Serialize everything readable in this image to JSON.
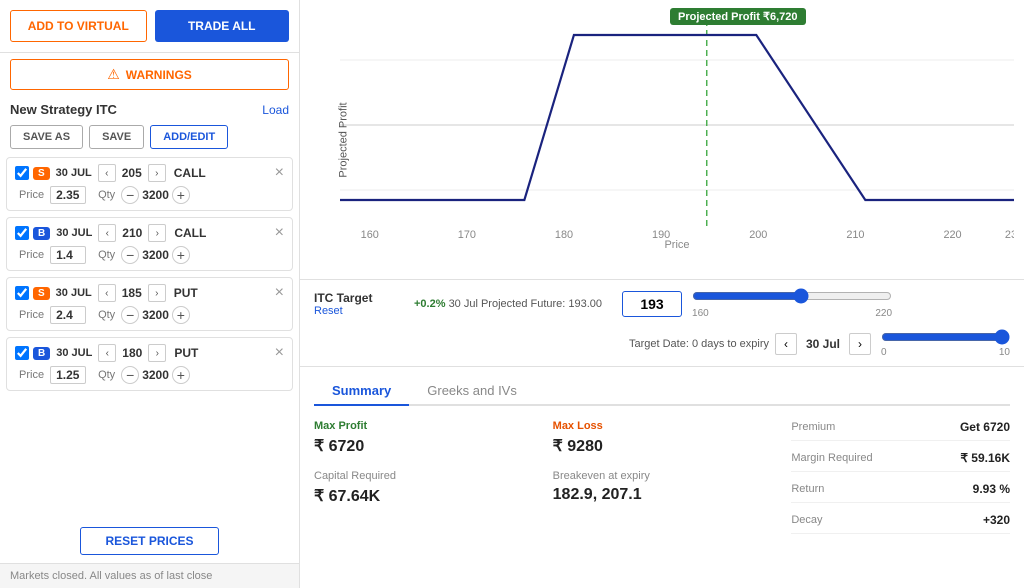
{
  "topButtons": {
    "addVirtual": "ADD TO VIRTUAL",
    "tradeAll": "TRADE ALL"
  },
  "warnings": {
    "label": "WARNINGS"
  },
  "strategy": {
    "name": "New Strategy ITC",
    "loadLabel": "Load"
  },
  "actionButtons": {
    "saveAs": "SAVE AS",
    "save": "SAVE",
    "addEdit": "ADD/EDIT"
  },
  "options": [
    {
      "type": "S",
      "date": "30 JUL",
      "strike": "205",
      "callPut": "CALL",
      "price": "2.35",
      "qty": "3200"
    },
    {
      "type": "B",
      "date": "30 JUL",
      "strike": "210",
      "callPut": "CALL",
      "price": "1.4",
      "qty": "3200"
    },
    {
      "type": "S",
      "date": "30 JUL",
      "strike": "185",
      "callPut": "PUT",
      "price": "2.4",
      "qty": "3200"
    },
    {
      "type": "B",
      "date": "30 JUL",
      "strike": "180",
      "callPut": "PUT",
      "price": "1.25",
      "qty": "3200"
    }
  ],
  "resetPrices": "RESET PRICES",
  "marketsNote": "Markets closed. All values as of last close",
  "chart": {
    "projectedProfitBadge": "Projected Profit ₹6,720",
    "yAxisLabel": "Projected Profit",
    "xAxisLabel": "Price"
  },
  "target": {
    "title": "ITC Target",
    "resetLabel": "Reset",
    "projectedChange": "+0.2%",
    "projectedFuture": "30 Jul Projected Future: 193.00",
    "inputValue": "193",
    "sliderMin": "160",
    "sliderMax": "220",
    "sliderValue": "193",
    "targetDateLabel": "Target Date: 0 days to expiry",
    "dateValue": "30 Jul",
    "dateSliderMin": "0",
    "dateSliderMax": "10",
    "dateSliderValue": "10"
  },
  "tabs": [
    {
      "label": "Summary",
      "active": true
    },
    {
      "label": "Greeks and IVs",
      "active": false
    }
  ],
  "summary": {
    "maxProfitLabel": "Max Profit",
    "maxProfitValue": "₹ 6720",
    "maxLossLabel": "Max Loss",
    "maxLossValue": "₹ 9280",
    "capitalRequiredLabel": "Capital Required",
    "capitalRequiredValue": "₹ 67.64K",
    "breakEvenLabel": "Breakeven at expiry",
    "breakEvenValue": "182.9, 207.1",
    "rightStats": [
      {
        "label": "Premium",
        "value": "Get 6720"
      },
      {
        "label": "Margin Required",
        "value": "₹ 59.16K"
      },
      {
        "label": "Return",
        "value": "9.93 %"
      },
      {
        "label": "Decay",
        "value": "+320"
      }
    ]
  }
}
